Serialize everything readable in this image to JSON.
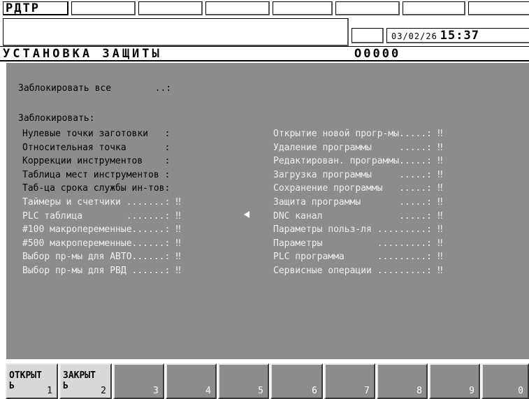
{
  "header": {
    "mode": "РДТР",
    "date": "03/02/26",
    "time": "15:37"
  },
  "title_bar": {
    "title": "УСТАНОВКА  ЗАЩИТЫ",
    "program_number": "O0000"
  },
  "lock_all": {
    "label": "Заблокировать все        ..:"
  },
  "section_label": "Заблокировать:",
  "left_items": [
    {
      "label": "Нулевые точки заготовки   :",
      "value": "",
      "dim": false
    },
    {
      "label": "Относительная точка       :",
      "value": "",
      "dim": false
    },
    {
      "label": "Коррекции инструментов    :",
      "value": "",
      "dim": false
    },
    {
      "label": "Таблица мест инструментов :",
      "value": "",
      "dim": false
    },
    {
      "label": "Таб-ца срока службы ин-тов:",
      "value": "",
      "dim": false
    },
    {
      "label": "Таймеры и счетчики .......:",
      "value": "‼",
      "dim": true
    },
    {
      "label": "PLC таблица        .......:",
      "value": "‼",
      "dim": true
    },
    {
      "label": "#100 макропеременные......:",
      "value": "‼",
      "dim": true
    },
    {
      "label": "#500 макропеременные......:",
      "value": "‼",
      "dim": true
    },
    {
      "label": "Выбор пр-мы для АВТО......:",
      "value": "‼",
      "dim": true
    },
    {
      "label": "Выбор пр-мы для РВД ......:",
      "value": "‼",
      "dim": true
    }
  ],
  "right_items": [
    {
      "label": "Открытие новой прогр-мы.....:",
      "value": "‼"
    },
    {
      "label": "Удаление программы     .....:",
      "value": "‼"
    },
    {
      "label": "Редактирован. программы.....:",
      "value": "‼"
    },
    {
      "label": "Загрузка программы     .....:",
      "value": "‼"
    },
    {
      "label": "Сохранение программы   .....:",
      "value": "‼"
    },
    {
      "label": "Защита программы       .....:",
      "value": "‼"
    },
    {
      "label": "DNC канал              .....:",
      "value": "‼"
    },
    {
      "label": "Параметры польз-ля .........:",
      "value": "‼"
    },
    {
      "label": "Параметры          .........:",
      "value": "‼"
    },
    {
      "label": "PLC программа      .........:",
      "value": "‼"
    },
    {
      "label": "Сервисные операции .........:",
      "value": "‼"
    }
  ],
  "softkeys": [
    {
      "label": "ОТКРЫТ\nЬ",
      "num": "1"
    },
    {
      "label": "ЗАКРЫТ\nЬ",
      "num": "2"
    },
    {
      "label": "",
      "num": "3"
    },
    {
      "label": "",
      "num": "4"
    },
    {
      "label": "",
      "num": "5"
    },
    {
      "label": "",
      "num": "6"
    },
    {
      "label": "",
      "num": "7"
    },
    {
      "label": "",
      "num": "8"
    },
    {
      "label": "",
      "num": "9"
    },
    {
      "label": "",
      "num": "0"
    }
  ],
  "colors": {
    "panel_background": "#8c8c8c",
    "header_background": "#ffffff",
    "active_text": "#000000",
    "dim_text": "#efefef"
  },
  "icons": {
    "cursor": "left-triangle-cursor-icon"
  }
}
